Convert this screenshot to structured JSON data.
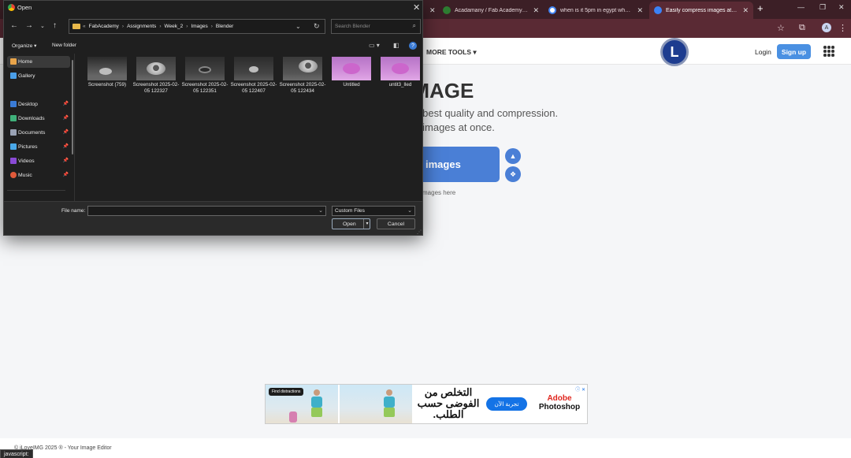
{
  "browser": {
    "tabs": [
      {
        "title": "Acadamany / Fab Academy / 2025",
        "color": "#2e7d32"
      },
      {
        "title": "when is it 5pm in egypt what is",
        "color": "#4285f4"
      },
      {
        "title": "Easily compress images at optimal",
        "color": "#3b82f6"
      }
    ],
    "profile_initial": "A"
  },
  "site": {
    "nav_more_tools": "MORE TOOLS",
    "logo_letter": "L",
    "login": "Login",
    "signup": "Sign up",
    "hero_title": "ss IMAGE",
    "hero_sub1": "th the best quality and compression.",
    "hero_sub2": "f your images at once.",
    "select_button": "images",
    "drop_hint": "mages here",
    "footer": "© iLoveIMG 2025 ® - Your Image Editor",
    "status_text": "javascript:",
    "ad": {
      "find_distractions": "Find distractions",
      "headline": "التخلص من الفوضى حسب الطلب.",
      "cta": "تجربة الآن",
      "brand_line1": "Adobe",
      "brand_line2": "Photoshop"
    }
  },
  "dialog": {
    "title": "Open",
    "breadcrumbs": [
      "FabAcademy",
      "Assignments",
      "Week_2",
      "Images",
      "Blender"
    ],
    "search_placeholder": "Search Blender",
    "organize": "Organize",
    "new_folder": "New folder",
    "nav_items": [
      {
        "label": "Home",
        "color": "#e8a44a",
        "selected": true,
        "pinned": false
      },
      {
        "label": "Gallery",
        "color": "#4a9ee8",
        "selected": false,
        "pinned": false
      },
      {
        "label": "Desktop",
        "color": "#3a7bd5",
        "selected": false,
        "pinned": true
      },
      {
        "label": "Downloads",
        "color": "#3fb07a",
        "selected": false,
        "pinned": true
      },
      {
        "label": "Documents",
        "color": "#9aa3b5",
        "selected": false,
        "pinned": true
      },
      {
        "label": "Pictures",
        "color": "#4aa8e8",
        "selected": false,
        "pinned": true
      },
      {
        "label": "Videos",
        "color": "#8a4ad5",
        "selected": false,
        "pinned": true
      },
      {
        "label": "Music",
        "color": "#e05a3a",
        "selected": false,
        "pinned": true
      }
    ],
    "files": [
      {
        "label": "Screenshot (759)",
        "thumb": "gray"
      },
      {
        "label": "Screenshot 2025-02-05 122327",
        "thumb": "gray"
      },
      {
        "label": "Screenshot 2025-02-05 122351",
        "thumb": "dark"
      },
      {
        "label": "Screenshot 2025-02-05 122407",
        "thumb": "dark"
      },
      {
        "label": "Screenshot 2025-02-05 122434",
        "thumb": "gray"
      },
      {
        "label": "Untitled",
        "thumb": "pink"
      },
      {
        "label": "untit3_lled",
        "thumb": "pink"
      }
    ],
    "file_name_label": "File name:",
    "file_name_value": "",
    "file_type": "Custom Files",
    "open_button": "Open",
    "cancel_button": "Cancel"
  }
}
